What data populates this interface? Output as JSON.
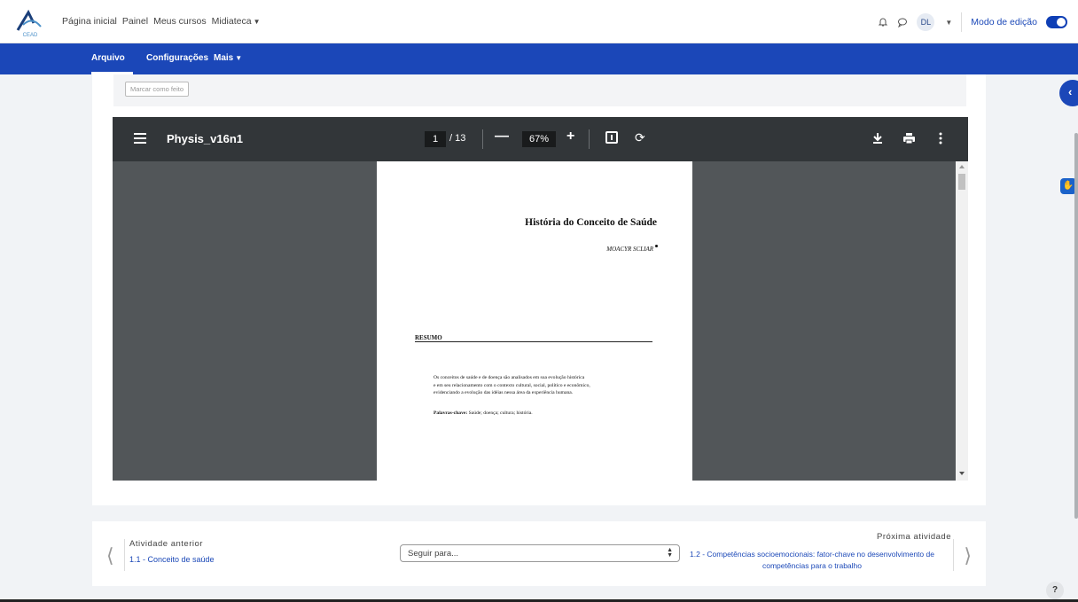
{
  "topbar": {
    "logo_text": "CEAD",
    "nav": [
      "Página inicial",
      "Painel",
      "Meus cursos",
      "Midiateca"
    ],
    "avatar": "DL",
    "edit_mode_label": "Modo de edição"
  },
  "secondary_nav": {
    "items": [
      "Arquivo",
      "Configurações",
      "Mais"
    ]
  },
  "activity": {
    "mark_done_label": "Marcar como feito"
  },
  "pdf_viewer": {
    "file_title": "Physis_v16n1",
    "current_page": "1",
    "total_pages": "/ 13",
    "zoom": "67%",
    "document": {
      "title": "História do Conceito de Saúde",
      "author": "MOACYR SCLIAR",
      "section": "RESUMO",
      "abstract_lines": [
        "Os conceitos de saúde e de doença são analisados em sua evolução histórica",
        "e em seu relacionamento com o contexto cultural, social, político e econômico,",
        "evidenciando a evolução das idéias nessa área da experiência humana."
      ],
      "keywords_label": "Palavras-chave:",
      "keywords": " Saúde; doença; cultura; história."
    }
  },
  "activity_nav": {
    "prev_label": "Atividade anterior",
    "prev_link": "1.1 - Conceito de saúde",
    "jump_placeholder": "Seguir para...",
    "next_label": "Próxima atividade",
    "next_link": "1.2 - Competências socioemocionais:  fator-chave no desenvolvimento de competências para o trabalho"
  },
  "help_label": "?"
}
